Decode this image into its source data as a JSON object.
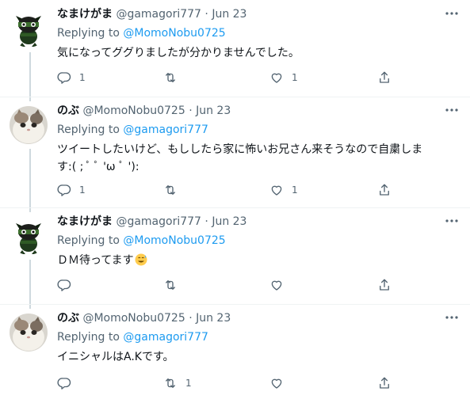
{
  "tweets": [
    {
      "display_name": "なまけがま",
      "handle": "@gamagori777",
      "separator": "·",
      "date": "Jun 23",
      "replying_prefix": "Replying to",
      "replying_to": "@MomoNobu0725",
      "text": "気になってググりましたが分かりませんでした。",
      "reply_count": "1",
      "retweet_count": "",
      "like_count": "1",
      "avatar": "frog-ninja-avatar"
    },
    {
      "display_name": "のぶ",
      "handle": "@MomoNobu0725",
      "separator": "·",
      "date": "Jun 23",
      "replying_prefix": "Replying to",
      "replying_to": "@gamagori777",
      "text": "ツイートしたいけど、もししたら家に怖いお兄さん来そうなので自粛しま\nす:( ; ﾟ ﾟ 'ω ﾟ '):",
      "reply_count": "1",
      "retweet_count": "",
      "like_count": "1",
      "avatar": "cat-photo-avatar"
    },
    {
      "display_name": "なまけがま",
      "handle": "@gamagori777",
      "separator": "·",
      "date": "Jun 23",
      "replying_prefix": "Replying to",
      "replying_to": "@MomoNobu0725",
      "text": "ＤＭ待ってます",
      "emoji": "grinning-sweat-emoji",
      "reply_count": "",
      "retweet_count": "",
      "like_count": "",
      "avatar": "frog-ninja-avatar"
    },
    {
      "display_name": "のぶ",
      "handle": "@MomoNobu0725",
      "separator": "·",
      "date": "Jun 23",
      "replying_prefix": "Replying to",
      "replying_to": "@gamagori777",
      "text": "イニシャルはA.Kです。",
      "reply_count": "",
      "retweet_count": "1",
      "like_count": "",
      "avatar": "cat-photo-avatar"
    }
  ],
  "icons": {
    "reply": "reply-icon",
    "retweet": "retweet-icon",
    "like": "heart-icon",
    "share": "share-icon",
    "more": "more-icon"
  },
  "colors": {
    "text": "#0f1419",
    "secondary": "#536471",
    "link": "#1d9bf0",
    "divider": "#eff3f4",
    "thread_line": "#cfd9de"
  }
}
